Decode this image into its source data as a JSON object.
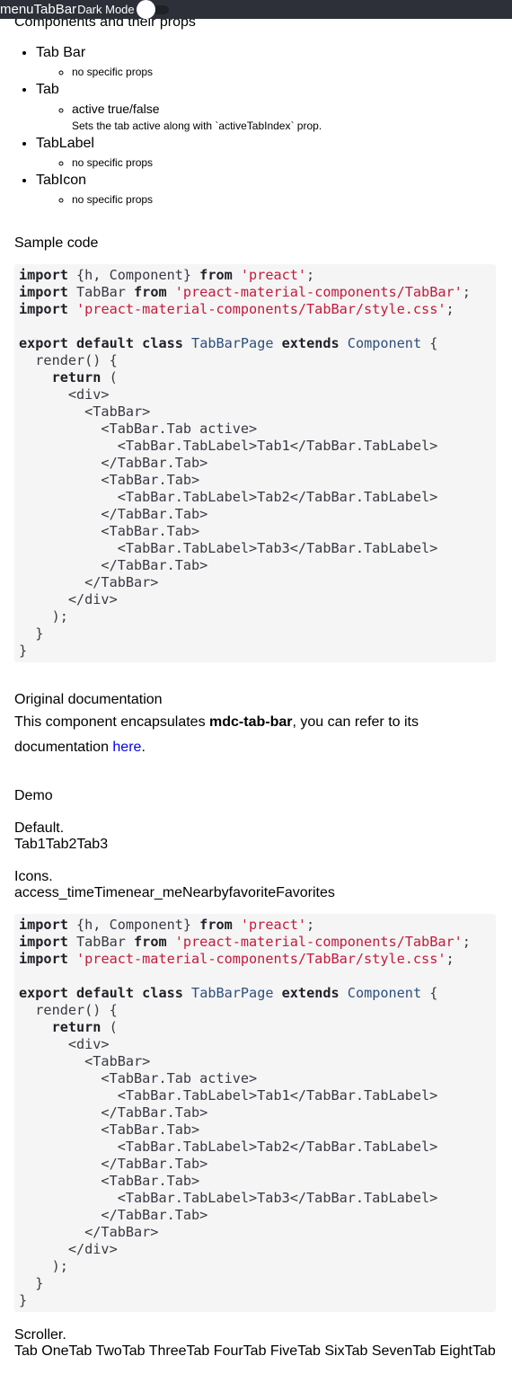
{
  "topbar": {
    "menu_icon_text": "menu",
    "title": "TabBar",
    "dark_mode_label": "Dark Mode"
  },
  "components_heading": "Components and their props",
  "components": [
    {
      "name": "Tab Bar",
      "props": [
        {
          "text": "no specific props"
        }
      ]
    },
    {
      "name": "Tab",
      "props": [
        {
          "name": "active",
          "values": "true/false",
          "description": "Sets the tab active along with `activeTabIndex` prop."
        }
      ]
    },
    {
      "name": "TabLabel",
      "props": [
        {
          "text": "no specific props"
        }
      ]
    },
    {
      "name": "TabIcon",
      "props": [
        {
          "text": "no specific props"
        }
      ]
    }
  ],
  "sample_code_label": "Sample code",
  "code_sample_1": {
    "l1a": "import ",
    "l1b": "{h, Component} ",
    "l1c": "from ",
    "l1d": "'preact'",
    "l1e": ";",
    "l2a": "import ",
    "l2b": "TabBar ",
    "l2c": "from ",
    "l2d": "'preact-material-components/TabBar'",
    "l2e": ";",
    "l3a": "import ",
    "l3b": "'preact-material-components/TabBar/style.css'",
    "l3c": ";",
    "l5a": "export ",
    "l5b": "default ",
    "l5c": "class ",
    "l5d": "TabBarPage ",
    "l5e": "extends ",
    "l5f": "Component",
    "l5g": " {",
    "l6": "  render() {",
    "l7a": "    ",
    "l7b": "return",
    "l7c": " (",
    "body": "      <div>\n        <TabBar>\n          <TabBar.Tab active>\n            <TabBar.TabLabel>Tab1</TabBar.TabLabel>\n          </TabBar.Tab>\n          <TabBar.Tab>\n            <TabBar.TabLabel>Tab2</TabBar.TabLabel>\n          </TabBar.Tab>\n          <TabBar.Tab>\n            <TabBar.TabLabel>Tab3</TabBar.TabLabel>\n          </TabBar.Tab>\n        </TabBar>\n      </div>\n    );\n  }\n}"
  },
  "original_doc": {
    "label": "Original documentation",
    "text_before": "This component encapsulates ",
    "component": "mdc-tab-bar",
    "text_mid": ", you can refer to its",
    "text_doc": "documentation ",
    "link": "here",
    "text_end": "."
  },
  "demo": {
    "label": "Demo",
    "default_label": "Default.",
    "default_tabs": [
      "Tab1",
      "Tab2",
      "Tab3"
    ],
    "icons_label": "Icons.",
    "icon_tabs": [
      {
        "icon": "access_time",
        "label": "Time"
      },
      {
        "icon": "near_me",
        "label": "Nearby"
      },
      {
        "icon": "favorite",
        "label": "Favorites"
      }
    ],
    "scroller_label": "Scroller.",
    "scroller_tabs": [
      "Tab One",
      "Tab Two",
      "Tab Three",
      "Tab Four",
      "Tab Five",
      "Tab Six",
      "Tab Seven",
      "Tab Eight",
      "Tab Nine"
    ]
  },
  "code_sample_2": {
    "l1a": "import ",
    "l1b": "{h, Component} ",
    "l1c": "from ",
    "l1d": "'preact'",
    "l1e": ";",
    "l2a": "import ",
    "l2b": "TabBar ",
    "l2c": "from ",
    "l2d": "'preact-material-components/TabBar'",
    "l2e": ";",
    "l3a": "import ",
    "l3b": "'preact-material-components/TabBar/style.css'",
    "l3c": ";",
    "l5a": "export ",
    "l5b": "default ",
    "l5c": "class ",
    "l5d": "TabBarPage ",
    "l5e": "extends ",
    "l5f": "Component",
    "l5g": " {",
    "l6": "  render() {",
    "l7a": "    ",
    "l7b": "return",
    "l7c": " (",
    "body": "      <div>\n        <TabBar>\n          <TabBar.Tab active>\n            <TabBar.TabLabel>Tab1</TabBar.TabLabel>\n          </TabBar.Tab>\n          <TabBar.Tab>\n            <TabBar.TabLabel>Tab2</TabBar.TabLabel>\n          </TabBar.Tab>\n          <TabBar.Tab>\n            <TabBar.TabLabel>Tab3</TabBar.TabLabel>\n          </TabBar.Tab>\n        </TabBar>\n      </div>\n    );\n  }\n}"
  },
  "colors": {
    "topbar_bg": "#2d3038",
    "code_bg": "#f5f5f5",
    "code_string": "#c41a3a",
    "code_class": "#2d4f7c",
    "link": "#0000ee"
  }
}
